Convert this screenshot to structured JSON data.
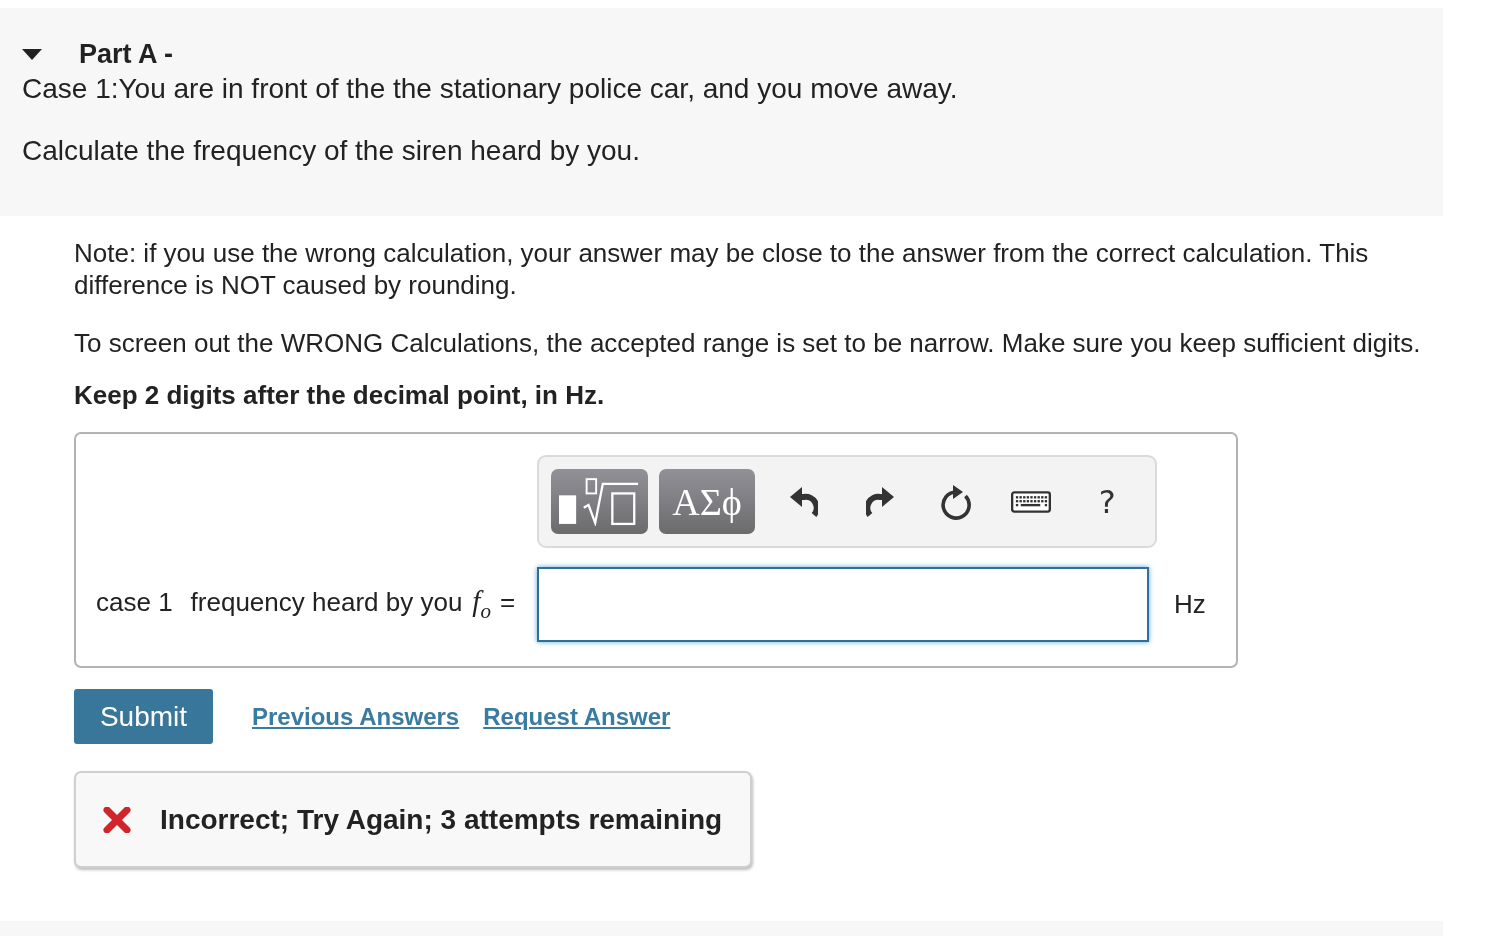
{
  "part": {
    "expanded": true,
    "title": "Part A -",
    "paragraphs": [
      "Case 1:You are in front of the the stationary police car, and you move away.",
      "Calculate the frequency of the siren heard by you."
    ]
  },
  "instructions": [
    {
      "kind": "note",
      "text": "Note: if you use the wrong calculation, your answer may be close to the answer from the correct calculation. This difference is NOT caused by rounding."
    },
    {
      "kind": "note",
      "text": "To screen out the WRONG Calculations, the accepted range is set to be narrow. Make sure you keep sufficient digits."
    },
    {
      "kind": "emphasis",
      "text": "Keep 2 digits after the decimal point, in Hz."
    }
  ],
  "answer": {
    "toolbar": [
      {
        "kind": "templates"
      },
      {
        "kind": "symbols",
        "label": "ΑΣϕ"
      },
      {
        "kind": "undo"
      },
      {
        "kind": "redo"
      },
      {
        "kind": "reset"
      },
      {
        "kind": "keyboard"
      },
      {
        "kind": "help",
        "label": "?"
      }
    ],
    "prefix": "case 1",
    "label": "frequency heard by you",
    "variable": "f$_{o}$",
    "operator": "=",
    "unit": "Hz"
  },
  "actions": {
    "submit": "Submit",
    "links": [
      "Previous Answers",
      "Request Answer"
    ]
  },
  "feedback": {
    "correct": false,
    "text": "Incorrect; Try Again; 3 attempts remaining"
  }
}
